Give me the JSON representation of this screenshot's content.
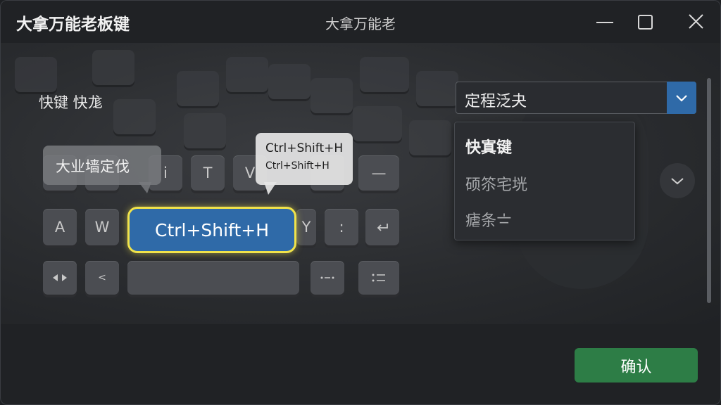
{
  "window": {
    "app_title": "大拿万能老板键",
    "center_title": "大拿万能老"
  },
  "left_label": "快键 快尨",
  "keys": {
    "row1": [
      "",
      "",
      "i",
      "T",
      "V",
      "",
      "—"
    ],
    "row2": [
      "A",
      "W",
      "Y",
      ":",
      ""
    ],
    "row3": [
      "",
      "<",
      "",
      "",
      ""
    ]
  },
  "hotkey": {
    "main": "Ctrl+Shift+H",
    "tooltip_line1": "Ctrl+Shift+H",
    "tooltip_line2": "Ctrl+Shift+H",
    "left_bubble": "大业墙定伐"
  },
  "select": {
    "value": "定程泛夬"
  },
  "dropdown": {
    "items": [
      "快寘键",
      "硕䇣宅垙",
      "瘧条〧"
    ]
  },
  "buttons": {
    "confirm": "确认"
  },
  "colors": {
    "accent": "#2f6aa8",
    "highlight": "#f1e34a",
    "confirm": "#2d7d46"
  }
}
